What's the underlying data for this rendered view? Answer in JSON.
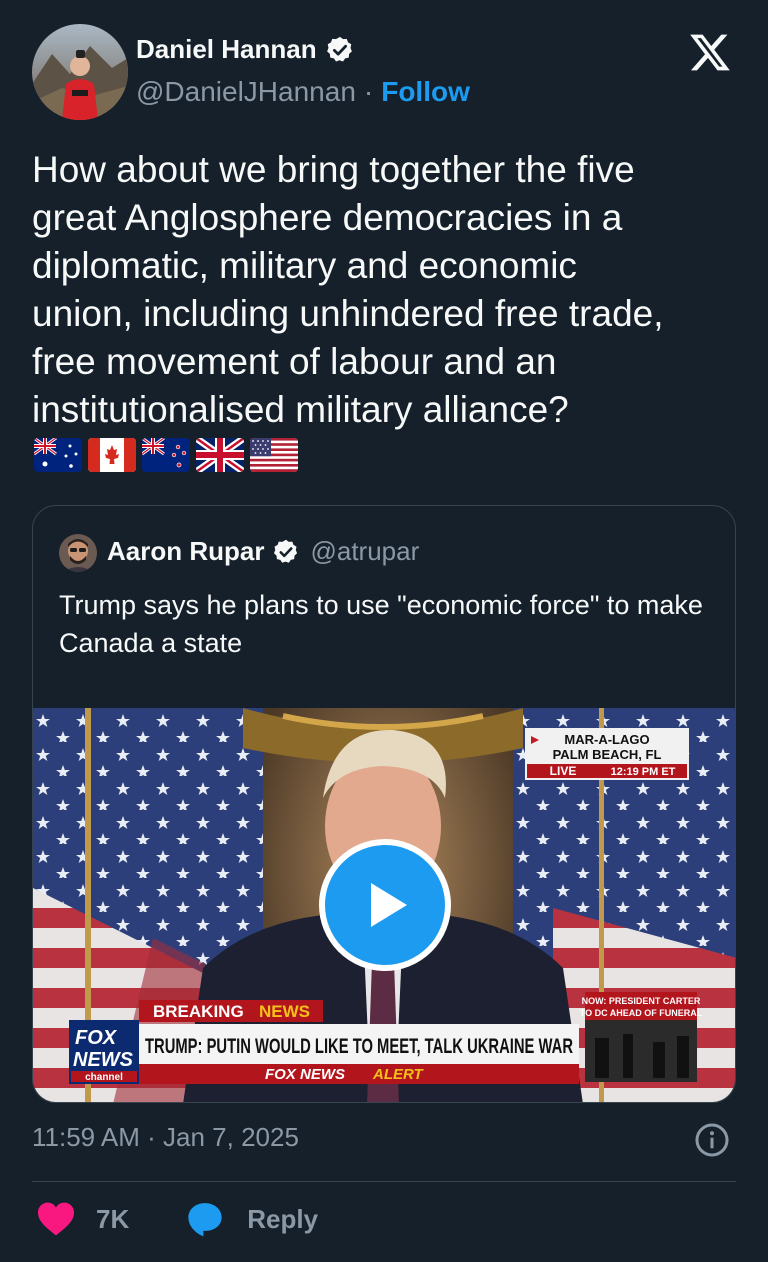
{
  "author": {
    "display_name": "Daniel Hannan",
    "handle": "@DanielJHannan",
    "separator": "·",
    "follow_label": "Follow"
  },
  "tweet": {
    "text": "How about we bring together the five\ngreat Anglosphere democracies in a\ndiplomatic, military and economic\nunion, including unhindered free trade,\nfree movement of labour and an\ninstitutionalised military alliance?",
    "flags": [
      "flag-australia",
      "flag-canada",
      "flag-new-zealand",
      "flag-united-kingdom",
      "flag-united-states"
    ]
  },
  "quoted": {
    "display_name": "Aaron Rupar",
    "handle": "@atrupar",
    "text": "Trump says he plans to use \"economic force\" to make Canada a state",
    "video": {
      "location_line1": "MAR-A-LAGO",
      "location_line2": "PALM BEACH, FL",
      "live_label": "LIVE",
      "time": "12:19 PM ET",
      "side_banner_line1": "NOW: PRESIDENT CARTER",
      "side_banner_line2": "TO DC AHEAD OF FUNERAL",
      "breaking": "BREAKING",
      "news": "NEWS",
      "headline": "TRUMP: PUTIN WOULD LIKE TO MEET, TALK UKRAINE WAR",
      "logo_line1": "FOX",
      "logo_line2": "NEWS",
      "logo_line3": "channel",
      "alert_fox_news": "FOX NEWS",
      "alert_word": "ALERT"
    }
  },
  "timestamp": "11:59 AM · Jan 7, 2025",
  "actions": {
    "likes": "7K",
    "reply_label": "Reply"
  },
  "colors": {
    "background": "#15202b",
    "accent": "#1d9bf0",
    "like": "#f91880",
    "secondary_text": "#8b98a5"
  }
}
